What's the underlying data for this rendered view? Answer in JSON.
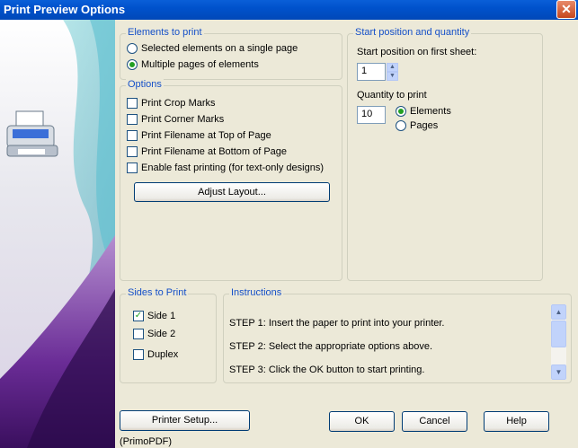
{
  "window": {
    "title": "Print Preview Options",
    "close_icon": "✕"
  },
  "elements_group": {
    "legend": "Elements to print",
    "options": [
      {
        "label": "Selected elements on a single page",
        "selected": false
      },
      {
        "label": "Multiple pages of elements",
        "selected": true
      }
    ]
  },
  "options_group": {
    "legend": "Options",
    "checks": [
      {
        "label": "Print Crop Marks",
        "checked": false
      },
      {
        "label": "Print Corner Marks",
        "checked": false
      },
      {
        "label": "Print Filename at Top of Page",
        "checked": false
      },
      {
        "label": "Print Filename at Bottom of Page",
        "checked": false
      },
      {
        "label": "Enable fast printing (for text-only designs)",
        "checked": false
      }
    ],
    "adjust_button": "Adjust Layout..."
  },
  "start_group": {
    "legend": "Start position and quantity",
    "start_label": "Start position on first sheet:",
    "start_value": "1",
    "qty_label": "Quantity to print",
    "qty_value": "10",
    "units": [
      {
        "label": "Elements",
        "selected": true
      },
      {
        "label": "Pages",
        "selected": false
      }
    ]
  },
  "sides_group": {
    "legend": "Sides to Print",
    "checks": [
      {
        "label": "Side 1",
        "checked": true
      },
      {
        "label": "Side 2",
        "checked": false
      },
      {
        "label": "Duplex",
        "checked": false
      }
    ]
  },
  "instructions_group": {
    "legend": "Instructions",
    "steps": [
      "STEP 1: Insert the paper to print into your printer.",
      "STEP 2: Select the appropriate options above.",
      "STEP 3: Click the OK button to start printing."
    ]
  },
  "buttons": {
    "printer_setup": "Printer Setup...",
    "ok": "OK",
    "cancel": "Cancel",
    "help": "Help"
  },
  "printer_name": "(PrimoPDF)",
  "colors": {
    "titlebar": "#0052cc",
    "legend": "#1550c8",
    "check_green": "#21a121"
  }
}
